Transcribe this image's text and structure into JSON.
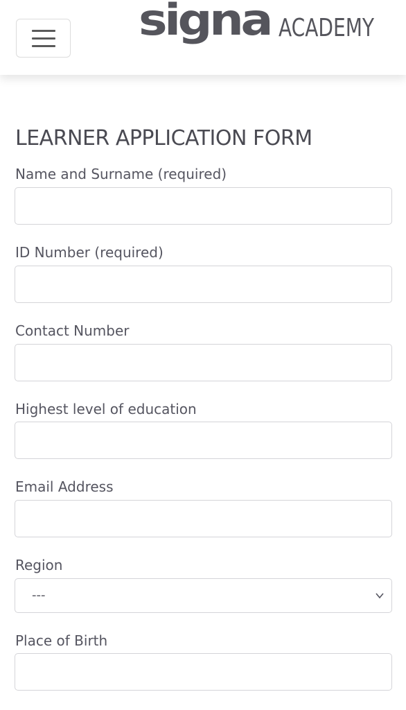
{
  "header": {
    "menu_icon": "hamburger-menu-icon",
    "brand_logo_text": "signa",
    "brand_suffix": "ACADEMY"
  },
  "form": {
    "title": "LEARNER APPLICATION FORM",
    "fields": [
      {
        "label": "Name and Surname (required)",
        "value": ""
      },
      {
        "label": "ID Number (required)",
        "value": ""
      },
      {
        "label": "Contact Number",
        "value": ""
      },
      {
        "label": "Highest level of education",
        "value": ""
      },
      {
        "label": "Email Address",
        "value": ""
      }
    ],
    "region": {
      "label": "Region",
      "selected": "---",
      "icon": "chevron-down-icon"
    },
    "place_of_birth": {
      "label": "Place of Birth",
      "value": ""
    }
  },
  "colors": {
    "text": "#4a4a52",
    "logo": "#55555c",
    "border": "#d4d4d8"
  }
}
